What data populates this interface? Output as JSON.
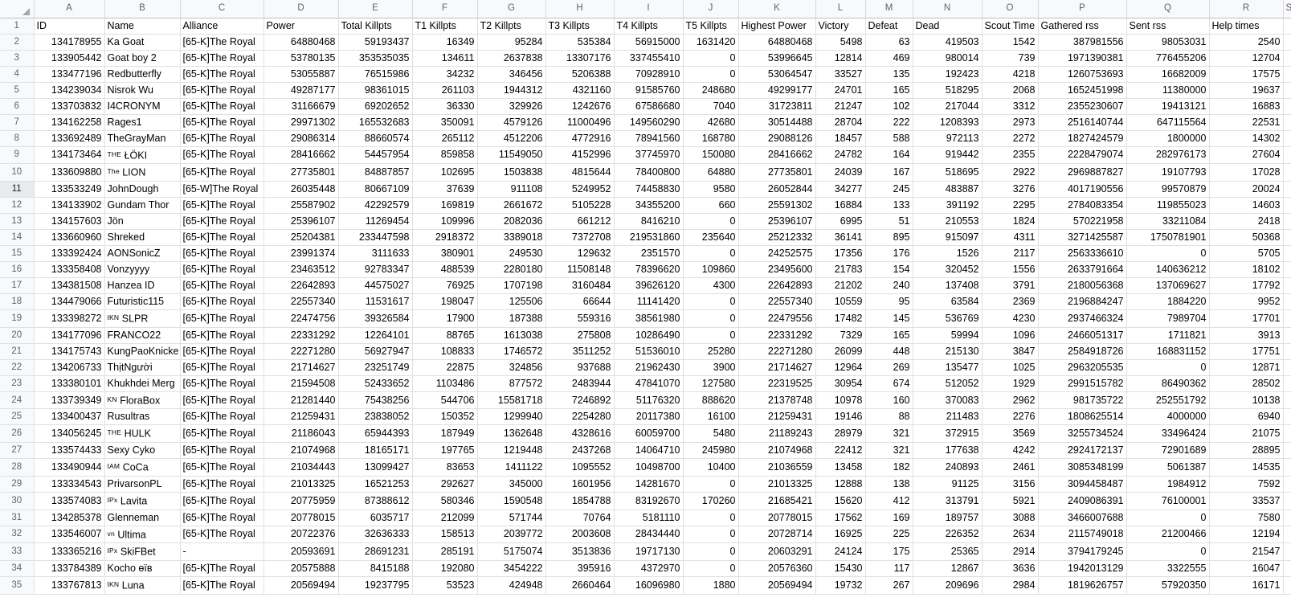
{
  "spreadsheet": {
    "select_all_icon": "select-all-corner-icon",
    "column_letters": [
      "A",
      "B",
      "C",
      "D",
      "E",
      "F",
      "G",
      "H",
      "I",
      "J",
      "K",
      "L",
      "M",
      "N",
      "O",
      "P",
      "Q",
      "R",
      "S"
    ],
    "selected_row_number": 11,
    "headers": [
      "ID",
      "Name",
      "Alliance",
      "Power",
      "Total Killpts",
      "T1 Killpts",
      "T2 Killpts",
      "T3 Killpts",
      "T4 Killpts",
      "T5 Killpts",
      "Highest Power",
      "Victory",
      "Defeat",
      "Dead",
      "Scout Time",
      "Gathered rss",
      "Sent rss",
      "Help times"
    ],
    "row_numbers": [
      1,
      2,
      3,
      4,
      5,
      6,
      7,
      8,
      9,
      10,
      11,
      12,
      13,
      14,
      15,
      16,
      17,
      18,
      19,
      20,
      21,
      22,
      23,
      24,
      25,
      26,
      27,
      28,
      29,
      30,
      31,
      32,
      33,
      34,
      35
    ],
    "rows": [
      {
        "n": 2,
        "id": "134178955",
        "name": "Ka Goat",
        "name_sup": "",
        "alliance": "[65-K]The Royal",
        "power": "64880468",
        "total": "59193437",
        "t1": "16349",
        "t2": "95284",
        "t3": "535384",
        "t4": "56915000",
        "t5": "1631420",
        "highest": "64880468",
        "victory": "5498",
        "defeat": "63",
        "dead": "419503",
        "scout": "1542",
        "gathered": "387981556",
        "sent": "98053031",
        "help": "2540"
      },
      {
        "n": 3,
        "id": "133905442",
        "name": "Goat boy 2",
        "name_sup": "",
        "alliance": "[65-K]The Royal",
        "power": "53780135",
        "total": "353535035",
        "t1": "134611",
        "t2": "2637838",
        "t3": "13307176",
        "t4": "337455410",
        "t5": "0",
        "highest": "53996645",
        "victory": "12814",
        "defeat": "469",
        "dead": "980014",
        "scout": "739",
        "gathered": "1971390381",
        "sent": "776455206",
        "help": "12704"
      },
      {
        "n": 4,
        "id": "133477196",
        "name": "Redbutterfly",
        "name_sup": "",
        "alliance": "[65-K]The Royal",
        "power": "53055887",
        "total": "76515986",
        "t1": "34232",
        "t2": "346456",
        "t3": "5206388",
        "t4": "70928910",
        "t5": "0",
        "highest": "53064547",
        "victory": "33527",
        "defeat": "135",
        "dead": "192423",
        "scout": "4218",
        "gathered": "1260753693",
        "sent": "16682009",
        "help": "17575"
      },
      {
        "n": 5,
        "id": "134239034",
        "name": "Nisrok Wu",
        "name_sup": "",
        "alliance": "[65-K]The Royal",
        "power": "49287177",
        "total": "98361015",
        "t1": "261103",
        "t2": "1944312",
        "t3": "4321160",
        "t4": "91585760",
        "t5": "248680",
        "highest": "49299177",
        "victory": "24701",
        "defeat": "165",
        "dead": "518295",
        "scout": "2068",
        "gathered": "1652451998",
        "sent": "11380000",
        "help": "19637"
      },
      {
        "n": 6,
        "id": "133703832",
        "name": "I4CRONYM",
        "name_sup": "",
        "alliance": "[65-K]The Royal",
        "power": "31166679",
        "total": "69202652",
        "t1": "36330",
        "t2": "329926",
        "t3": "1242676",
        "t4": "67586680",
        "t5": "7040",
        "highest": "31723811",
        "victory": "21247",
        "defeat": "102",
        "dead": "217044",
        "scout": "3312",
        "gathered": "2355230607",
        "sent": "19413121",
        "help": "16883"
      },
      {
        "n": 7,
        "id": "134162258",
        "name": "Rages1",
        "name_sup": "",
        "alliance": "[65-K]The Royal",
        "power": "29971302",
        "total": "165532683",
        "t1": "350091",
        "t2": "4579126",
        "t3": "11000496",
        "t4": "149560290",
        "t5": "42680",
        "highest": "30514488",
        "victory": "28704",
        "defeat": "222",
        "dead": "1208393",
        "scout": "2973",
        "gathered": "2516140744",
        "sent": "647115564",
        "help": "22531"
      },
      {
        "n": 8,
        "id": "133692489",
        "name": "TheGrayMan",
        "name_sup": "",
        "alliance": "[65-K]The Royal",
        "power": "29086314",
        "total": "88660574",
        "t1": "265112",
        "t2": "4512206",
        "t3": "4772916",
        "t4": "78941560",
        "t5": "168780",
        "highest": "29088126",
        "victory": "18457",
        "defeat": "588",
        "dead": "972113",
        "scout": "2272",
        "gathered": "1827424579",
        "sent": "1800000",
        "help": "14302"
      },
      {
        "n": 9,
        "id": "134173464",
        "name": "ŁÖKI",
        "name_sup": "THE",
        "alliance": "[65-K]The Royal",
        "power": "28416662",
        "total": "54457954",
        "t1": "859858",
        "t2": "11549050",
        "t3": "4152996",
        "t4": "37745970",
        "t5": "150080",
        "highest": "28416662",
        "victory": "24782",
        "defeat": "164",
        "dead": "919442",
        "scout": "2355",
        "gathered": "2228479074",
        "sent": "282976173",
        "help": "27604"
      },
      {
        "n": 10,
        "id": "133609880",
        "name": "LION",
        "name_sup": "The",
        "alliance": "[65-K]The Royal",
        "power": "27735801",
        "total": "84887857",
        "t1": "102695",
        "t2": "1503838",
        "t3": "4815644",
        "t4": "78400800",
        "t5": "64880",
        "highest": "27735801",
        "victory": "24039",
        "defeat": "167",
        "dead": "518695",
        "scout": "2922",
        "gathered": "2969887827",
        "sent": "19107793",
        "help": "17028"
      },
      {
        "n": 11,
        "id": "133533249",
        "name": "JohnDough",
        "name_sup": "",
        "alliance": "[65-W]The Royal",
        "power": "26035448",
        "total": "80667109",
        "t1": "37639",
        "t2": "911108",
        "t3": "5249952",
        "t4": "74458830",
        "t5": "9580",
        "highest": "26052844",
        "victory": "34277",
        "defeat": "245",
        "dead": "483887",
        "scout": "3276",
        "gathered": "4017190556",
        "sent": "99570879",
        "help": "20024"
      },
      {
        "n": 12,
        "id": "134133902",
        "name": "Gundam Thor",
        "name_sup": "",
        "alliance": "[65-K]The Royal",
        "power": "25587902",
        "total": "42292579",
        "t1": "169819",
        "t2": "2661672",
        "t3": "5105228",
        "t4": "34355200",
        "t5": "660",
        "highest": "25591302",
        "victory": "16884",
        "defeat": "133",
        "dead": "391192",
        "scout": "2295",
        "gathered": "2784083354",
        "sent": "119855023",
        "help": "14603"
      },
      {
        "n": 13,
        "id": "134157603",
        "name": "Jön",
        "name_sup": "",
        "alliance": "[65-K]The Royal",
        "power": "25396107",
        "total": "11269454",
        "t1": "109996",
        "t2": "2082036",
        "t3": "661212",
        "t4": "8416210",
        "t5": "0",
        "highest": "25396107",
        "victory": "6995",
        "defeat": "51",
        "dead": "210553",
        "scout": "1824",
        "gathered": "570221958",
        "sent": "33211084",
        "help": "2418"
      },
      {
        "n": 14,
        "id": "133660960",
        "name": "Shreked",
        "name_sup": "",
        "alliance": "[65-K]The Royal",
        "power": "25204381",
        "total": "233447598",
        "t1": "2918372",
        "t2": "3389018",
        "t3": "7372708",
        "t4": "219531860",
        "t5": "235640",
        "highest": "25212332",
        "victory": "36141",
        "defeat": "895",
        "dead": "915097",
        "scout": "4311",
        "gathered": "3271425587",
        "sent": "1750781901",
        "help": "50368"
      },
      {
        "n": 15,
        "id": "133392424",
        "name": "AONSonicZ",
        "name_sup": "",
        "alliance": "[65-K]The Royal",
        "power": "23991374",
        "total": "3111633",
        "t1": "380901",
        "t2": "249530",
        "t3": "129632",
        "t4": "2351570",
        "t5": "0",
        "highest": "24252575",
        "victory": "17356",
        "defeat": "176",
        "dead": "1526",
        "scout": "2117",
        "gathered": "2563336610",
        "sent": "0",
        "help": "5705"
      },
      {
        "n": 16,
        "id": "133358408",
        "name": "Vonzyyyy",
        "name_sup": "",
        "alliance": "[65-K]The Royal",
        "power": "23463512",
        "total": "92783347",
        "t1": "488539",
        "t2": "2280180",
        "t3": "11508148",
        "t4": "78396620",
        "t5": "109860",
        "highest": "23495600",
        "victory": "21783",
        "defeat": "154",
        "dead": "320452",
        "scout": "1556",
        "gathered": "2633791664",
        "sent": "140636212",
        "help": "18102"
      },
      {
        "n": 17,
        "id": "134381508",
        "name": "Hanzea ID",
        "name_sup": "",
        "alliance": "[65-K]The Royal",
        "power": "22642893",
        "total": "44575027",
        "t1": "76925",
        "t2": "1707198",
        "t3": "3160484",
        "t4": "39626120",
        "t5": "4300",
        "highest": "22642893",
        "victory": "21202",
        "defeat": "240",
        "dead": "137408",
        "scout": "3791",
        "gathered": "2180056368",
        "sent": "137069627",
        "help": "17792"
      },
      {
        "n": 18,
        "id": "134479066",
        "name": "Futuristic115",
        "name_sup": "",
        "alliance": "[65-K]The Royal",
        "power": "22557340",
        "total": "11531617",
        "t1": "198047",
        "t2": "125506",
        "t3": "66644",
        "t4": "11141420",
        "t5": "0",
        "highest": "22557340",
        "victory": "10559",
        "defeat": "95",
        "dead": "63584",
        "scout": "2369",
        "gathered": "2196884247",
        "sent": "1884220",
        "help": "9952"
      },
      {
        "n": 19,
        "id": "133398272",
        "name": "SLPR",
        "name_sup": "IKN",
        "alliance": "[65-K]The Royal",
        "power": "22474756",
        "total": "39326584",
        "t1": "17900",
        "t2": "187388",
        "t3": "559316",
        "t4": "38561980",
        "t5": "0",
        "highest": "22479556",
        "victory": "17482",
        "defeat": "145",
        "dead": "536769",
        "scout": "4230",
        "gathered": "2937466324",
        "sent": "7989704",
        "help": "17701"
      },
      {
        "n": 20,
        "id": "134177096",
        "name": "FRANCO22",
        "name_sup": "",
        "alliance": "[65-K]The Royal",
        "power": "22331292",
        "total": "12264101",
        "t1": "88765",
        "t2": "1613038",
        "t3": "275808",
        "t4": "10286490",
        "t5": "0",
        "highest": "22331292",
        "victory": "7329",
        "defeat": "165",
        "dead": "59994",
        "scout": "1096",
        "gathered": "2466051317",
        "sent": "1711821",
        "help": "3913"
      },
      {
        "n": 21,
        "id": "134175743",
        "name": "KungPaoKnicke",
        "name_sup": "",
        "alliance": "[65-K]The Royal",
        "power": "22271280",
        "total": "56927947",
        "t1": "108833",
        "t2": "1746572",
        "t3": "3511252",
        "t4": "51536010",
        "t5": "25280",
        "highest": "22271280",
        "victory": "26099",
        "defeat": "448",
        "dead": "215130",
        "scout": "3847",
        "gathered": "2584918726",
        "sent": "168831152",
        "help": "17751"
      },
      {
        "n": 22,
        "id": "134206733",
        "name": "ThịtNgười",
        "name_sup": "",
        "alliance": "[65-K]The Royal",
        "power": "21714627",
        "total": "23251749",
        "t1": "22875",
        "t2": "324856",
        "t3": "937688",
        "t4": "21962430",
        "t5": "3900",
        "highest": "21714627",
        "victory": "12964",
        "defeat": "269",
        "dead": "135477",
        "scout": "1025",
        "gathered": "2963205535",
        "sent": "0",
        "help": "12871"
      },
      {
        "n": 23,
        "id": "133380101",
        "name": "Khukhdei Merg",
        "name_sup": "",
        "alliance": "[65-K]The Royal",
        "power": "21594508",
        "total": "52433652",
        "t1": "1103486",
        "t2": "877572",
        "t3": "2483944",
        "t4": "47841070",
        "t5": "127580",
        "highest": "22319525",
        "victory": "30954",
        "defeat": "674",
        "dead": "512052",
        "scout": "1929",
        "gathered": "2991515782",
        "sent": "86490362",
        "help": "28502"
      },
      {
        "n": 24,
        "id": "133739349",
        "name": "FloraBox",
        "name_sup": "KN",
        "alliance": "[65-K]The Royal",
        "power": "21281440",
        "total": "75438256",
        "t1": "544706",
        "t2": "15581718",
        "t3": "7246892",
        "t4": "51176320",
        "t5": "888620",
        "highest": "21378748",
        "victory": "10978",
        "defeat": "160",
        "dead": "370083",
        "scout": "2962",
        "gathered": "981735722",
        "sent": "252551792",
        "help": "10138"
      },
      {
        "n": 25,
        "id": "133400437",
        "name": "Rusultras",
        "name_sup": "",
        "alliance": "[65-K]The Royal",
        "power": "21259431",
        "total": "23838052",
        "t1": "150352",
        "t2": "1299940",
        "t3": "2254280",
        "t4": "20117380",
        "t5": "16100",
        "highest": "21259431",
        "victory": "19146",
        "defeat": "88",
        "dead": "211483",
        "scout": "2276",
        "gathered": "1808625514",
        "sent": "4000000",
        "help": "6940"
      },
      {
        "n": 26,
        "id": "134056245",
        "name": "HULK",
        "name_sup": "THE",
        "alliance": "[65-K]The Royal",
        "power": "21186043",
        "total": "65944393",
        "t1": "187949",
        "t2": "1362648",
        "t3": "4328616",
        "t4": "60059700",
        "t5": "5480",
        "highest": "21189243",
        "victory": "28979",
        "defeat": "321",
        "dead": "372915",
        "scout": "3569",
        "gathered": "3255734524",
        "sent": "33496424",
        "help": "21075"
      },
      {
        "n": 27,
        "id": "133574433",
        "name": "Sexy Cyko",
        "name_sup": "",
        "alliance": "[65-K]The Royal",
        "power": "21074968",
        "total": "18165171",
        "t1": "197765",
        "t2": "1219448",
        "t3": "2437268",
        "t4": "14064710",
        "t5": "245980",
        "highest": "21074968",
        "victory": "22412",
        "defeat": "321",
        "dead": "177638",
        "scout": "4242",
        "gathered": "2924172137",
        "sent": "72901689",
        "help": "28895"
      },
      {
        "n": 28,
        "id": "133490944",
        "name": "CoCa",
        "name_sup": "IAM",
        "alliance": "[65-K]The Royal",
        "power": "21034443",
        "total": "13099427",
        "t1": "83653",
        "t2": "1411122",
        "t3": "1095552",
        "t4": "10498700",
        "t5": "10400",
        "highest": "21036559",
        "victory": "13458",
        "defeat": "182",
        "dead": "240893",
        "scout": "2461",
        "gathered": "3085348199",
        "sent": "5061387",
        "help": "14535"
      },
      {
        "n": 29,
        "id": "133334543",
        "name": "PrivarsonPL",
        "name_sup": "",
        "alliance": "[65-K]The Royal",
        "power": "21013325",
        "total": "16521253",
        "t1": "292627",
        "t2": "345000",
        "t3": "1601956",
        "t4": "14281670",
        "t5": "0",
        "highest": "21013325",
        "victory": "12888",
        "defeat": "138",
        "dead": "91125",
        "scout": "3156",
        "gathered": "3094458487",
        "sent": "1984912",
        "help": "7592"
      },
      {
        "n": 30,
        "id": "133574083",
        "name": "Lavita",
        "name_sup": "IPx",
        "alliance": "[65-K]The Royal",
        "power": "20775959",
        "total": "87388612",
        "t1": "580346",
        "t2": "1590548",
        "t3": "1854788",
        "t4": "83192670",
        "t5": "170260",
        "highest": "21685421",
        "victory": "15620",
        "defeat": "412",
        "dead": "313791",
        "scout": "5921",
        "gathered": "2409086391",
        "sent": "76100001",
        "help": "33537"
      },
      {
        "n": 31,
        "id": "134285378",
        "name": "Glenneman",
        "name_sup": "",
        "alliance": "[65-K]The Royal",
        "power": "20778015",
        "total": "6035717",
        "t1": "212099",
        "t2": "571744",
        "t3": "70764",
        "t4": "5181110",
        "t5": "0",
        "highest": "20778015",
        "victory": "17562",
        "defeat": "169",
        "dead": "189757",
        "scout": "3088",
        "gathered": "3466007688",
        "sent": "0",
        "help": "7580"
      },
      {
        "n": 32,
        "id": "133546007",
        "name": "Ultima",
        "name_sup": "vn",
        "alliance": "[65-K]The Royal",
        "power": "20722376",
        "total": "32636333",
        "t1": "158513",
        "t2": "2039772",
        "t3": "2003608",
        "t4": "28434440",
        "t5": "0",
        "highest": "20728714",
        "victory": "16925",
        "defeat": "225",
        "dead": "226352",
        "scout": "2634",
        "gathered": "2115749018",
        "sent": "21200466",
        "help": "12194"
      },
      {
        "n": 33,
        "id": "133365216",
        "name": "SkiFBet",
        "name_sup": "IPx",
        "alliance": "-",
        "power": "20593691",
        "total": "28691231",
        "t1": "285191",
        "t2": "5175074",
        "t3": "3513836",
        "t4": "19717130",
        "t5": "0",
        "highest": "20603291",
        "victory": "24124",
        "defeat": "175",
        "dead": "25365",
        "scout": "2914",
        "gathered": "3794179245",
        "sent": "0",
        "help": "21547"
      },
      {
        "n": 34,
        "id": "133784389",
        "name": "Kocho ɵïʙ",
        "name_sup": "",
        "alliance": "[65-K]The Royal",
        "power": "20575888",
        "total": "8415188",
        "t1": "192080",
        "t2": "3454222",
        "t3": "395916",
        "t4": "4372970",
        "t5": "0",
        "highest": "20576360",
        "victory": "15430",
        "defeat": "117",
        "dead": "12867",
        "scout": "3636",
        "gathered": "1942013129",
        "sent": "3322555",
        "help": "16047"
      },
      {
        "n": 35,
        "id": "133767813",
        "name": "Luna",
        "name_sup": "IKN",
        "alliance": "[65-K]The Royal",
        "power": "20569494",
        "total": "19237795",
        "t1": "53523",
        "t2": "424948",
        "t3": "2660464",
        "t4": "16096980",
        "t5": "1880",
        "highest": "20569494",
        "victory": "19732",
        "defeat": "267",
        "dead": "209696",
        "scout": "2984",
        "gathered": "1819626757",
        "sent": "57920350",
        "help": "16171"
      }
    ]
  }
}
